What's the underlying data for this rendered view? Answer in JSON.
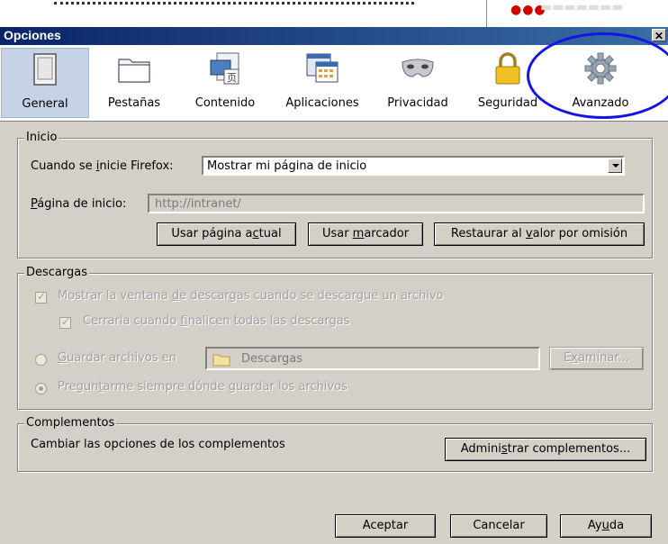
{
  "window": {
    "title": "Opciones",
    "close_glyph": "✕"
  },
  "toolbar": {
    "tabs": [
      {
        "label": "General",
        "icon": "general-switch-icon"
      },
      {
        "label": "Pestañas",
        "icon": "tabs-folder-icon"
      },
      {
        "label": "Contenido",
        "icon": "content-page-icon"
      },
      {
        "label": "Aplicaciones",
        "icon": "applications-calendar-icon"
      },
      {
        "label": "Privacidad",
        "icon": "privacy-mask-icon"
      },
      {
        "label": "Seguridad",
        "icon": "security-padlock-icon"
      },
      {
        "label": "Avanzado",
        "icon": "advanced-gear-icon"
      }
    ],
    "selected": "General"
  },
  "inicio": {
    "legend": "Inicio",
    "startup_label_pre": "Cuando se ",
    "startup_label_key": "i",
    "startup_label_post": "nicie Firefox:",
    "startup_value": "Mostrar mi página de inicio",
    "homepage_label_key": "P",
    "homepage_label_post": "ágina de inicio:",
    "homepage_value": "http://intranet/",
    "btn_current_pre": "Usar página a",
    "btn_current_key": "c",
    "btn_current_post": "tual",
    "btn_bookmark_pre": "Usar ",
    "btn_bookmark_key": "m",
    "btn_bookmark_post": "arcador",
    "btn_restore_pre": "Restaurar al ",
    "btn_restore_key": "v",
    "btn_restore_post": "alor por omisión"
  },
  "descargas": {
    "legend": "Descargas",
    "show_window_pre": "Mostrar la ventana ",
    "show_window_key": "d",
    "show_window_post": "e descargas cuando se descargue un archivo",
    "show_window_checked": true,
    "close_when_pre": "Cerrarla cuando ",
    "close_when_key": "f",
    "close_when_post": "inalicen todas las descargas",
    "close_when_checked": true,
    "save_to_key": "G",
    "save_to_post": "uardar archivos en",
    "save_to_selected": false,
    "folder_value": "Descargas",
    "browse_pre": "E",
    "browse_key": "x",
    "browse_post": "aminar...",
    "ask_pre": "Pregun",
    "ask_key": "t",
    "ask_post": "arme siempre dónde guardar los archivos",
    "ask_selected": true
  },
  "complementos": {
    "legend": "Complementos",
    "description": "Cambiar las opciones de los complementos",
    "btn_manage_pre": "Admini",
    "btn_manage_key": "s",
    "btn_manage_post": "trar complementos..."
  },
  "footer": {
    "accept": "Aceptar",
    "cancel": "Cancelar",
    "help_pre": "Ay",
    "help_key": "u",
    "help_post": "da"
  },
  "colors": {
    "title_bar": "#0a246a",
    "highlight_oval": "#1414e6",
    "dialog_bg": "#d4d0c8"
  }
}
